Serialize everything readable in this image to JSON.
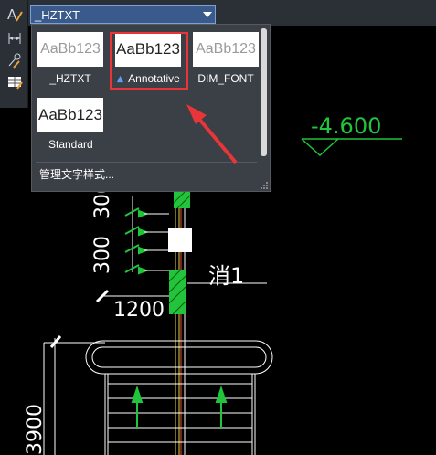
{
  "text_style_combo": {
    "value": "_HZTXT"
  },
  "gallery": {
    "styles": [
      {
        "sample": "AaBb123",
        "name": "_HZTXT"
      },
      {
        "sample": "AaBb123",
        "name": "Annotative",
        "selected": true
      },
      {
        "sample": "AaBb123",
        "name": "DIM_FONT"
      },
      {
        "sample": "AaBb123",
        "name": "Standard"
      }
    ],
    "manage_link": "管理文字样式..."
  },
  "drawing": {
    "elevation_text": "-4.600",
    "dim_300_a": "300",
    "dim_300_b": "300",
    "dim_1200": "1200",
    "dim_3900": "3900",
    "label_xiao": "消1"
  },
  "colors": {
    "background": "#000000",
    "highlight_frame": "#e8353a",
    "green": "#21c43a",
    "yellow": "#e8d53a"
  },
  "icons": [
    "text-style-icon",
    "dimension-style-icon",
    "multileader-style-icon",
    "table-style-icon"
  ]
}
